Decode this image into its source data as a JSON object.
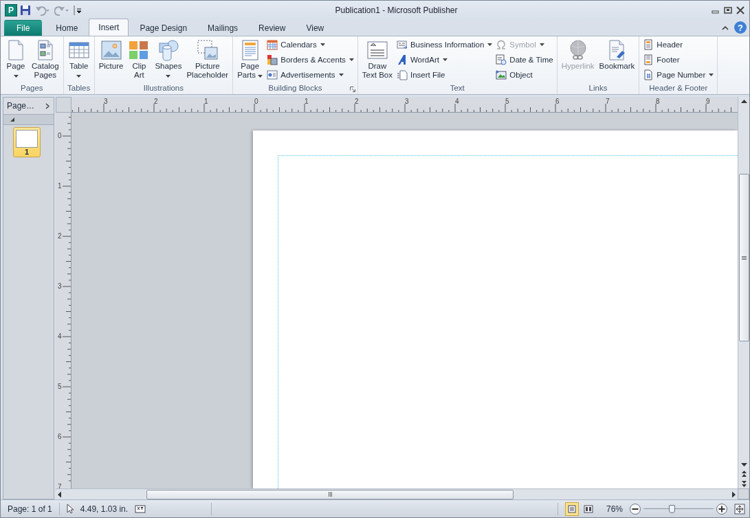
{
  "window": {
    "logo": "P",
    "title": "Publication1 - Microsoft Publisher"
  },
  "ribbon_tabs": [
    {
      "label": "File",
      "kind": "file",
      "selected": false
    },
    {
      "label": "Home",
      "kind": "tab",
      "selected": false
    },
    {
      "label": "Insert",
      "kind": "tab",
      "selected": true
    },
    {
      "label": "Page Design",
      "kind": "tab",
      "selected": false
    },
    {
      "label": "Mailings",
      "kind": "tab",
      "selected": false
    },
    {
      "label": "Review",
      "kind": "tab",
      "selected": false
    },
    {
      "label": "View",
      "kind": "tab",
      "selected": false
    }
  ],
  "help": "?",
  "ribbon": {
    "groups": [
      {
        "label": "Pages",
        "launcher": false,
        "items": [
          {
            "kind": "large",
            "lines": [
              "Page"
            ],
            "dropdown": true,
            "disabled": false
          },
          {
            "kind": "large",
            "lines": [
              "Catalog",
              "Pages"
            ],
            "dropdown": false,
            "disabled": false
          }
        ]
      },
      {
        "label": "Tables",
        "launcher": false,
        "items": [
          {
            "kind": "large",
            "lines": [
              "Table"
            ],
            "dropdown": true,
            "disabled": false
          }
        ]
      },
      {
        "label": "Illustrations",
        "launcher": false,
        "items": [
          {
            "kind": "large",
            "lines": [
              "Picture"
            ],
            "dropdown": false,
            "disabled": false
          },
          {
            "kind": "large",
            "lines": [
              "Clip",
              "Art"
            ],
            "dropdown": false,
            "disabled": false
          },
          {
            "kind": "large",
            "lines": [
              "Shapes"
            ],
            "dropdown": true,
            "disabled": false
          },
          {
            "kind": "large",
            "lines": [
              "Picture",
              "Placeholder"
            ],
            "dropdown": false,
            "disabled": false
          }
        ]
      },
      {
        "label": "Building Blocks",
        "launcher": true,
        "items": [
          {
            "kind": "large",
            "lines": [
              "Page",
              "Parts"
            ],
            "dropdown": true,
            "disabled": false
          },
          {
            "kind": "column",
            "buttons": [
              {
                "label": "Calendars",
                "dropdown": true,
                "disabled": false
              },
              {
                "label": "Borders & Accents",
                "dropdown": true,
                "disabled": false
              },
              {
                "label": "Advertisements",
                "dropdown": true,
                "disabled": false
              }
            ]
          }
        ]
      },
      {
        "label": "Text",
        "launcher": false,
        "items": [
          {
            "kind": "large",
            "lines": [
              "Draw",
              "Text Box"
            ],
            "dropdown": false,
            "disabled": false
          },
          {
            "kind": "column",
            "buttons": [
              {
                "label": "Business Information",
                "dropdown": true,
                "disabled": false
              },
              {
                "label": "WordArt",
                "dropdown": true,
                "disabled": false
              },
              {
                "label": "Insert File",
                "dropdown": false,
                "disabled": false
              }
            ]
          },
          {
            "kind": "column",
            "buttons": [
              {
                "label": "Symbol",
                "dropdown": true,
                "disabled": true
              },
              {
                "label": "Date & Time",
                "dropdown": false,
                "disabled": false
              },
              {
                "label": "Object",
                "dropdown": false,
                "disabled": false
              }
            ]
          }
        ]
      },
      {
        "label": "Links",
        "launcher": false,
        "items": [
          {
            "kind": "large",
            "lines": [
              "Hyperlink"
            ],
            "dropdown": false,
            "disabled": true
          },
          {
            "kind": "large",
            "lines": [
              "Bookmark"
            ],
            "dropdown": false,
            "disabled": false
          }
        ]
      },
      {
        "label": "Header & Footer",
        "launcher": false,
        "items": [
          {
            "kind": "column",
            "buttons": [
              {
                "label": "Header",
                "dropdown": false,
                "disabled": false
              },
              {
                "label": "Footer",
                "dropdown": false,
                "disabled": false
              },
              {
                "label": "Page Number",
                "dropdown": true,
                "disabled": false
              }
            ]
          }
        ]
      }
    ]
  },
  "page_navigation": {
    "title": "Page…",
    "pages": [
      {
        "number": "1",
        "selected": true
      }
    ]
  },
  "rulers": {
    "horizontal": [
      "3",
      "2",
      "1",
      "0",
      "1",
      "2",
      "3",
      "4",
      "5",
      "6",
      "7",
      "8",
      "9"
    ],
    "vertical": [
      "0",
      "1",
      "2",
      "3",
      "4",
      "5",
      "6",
      "7"
    ]
  },
  "status_bar": {
    "page": "Page: 1 of 1",
    "position": "4.49, 1.03 in.",
    "views": [
      {
        "selected": true
      },
      {
        "selected": false
      }
    ],
    "zoom": "76%",
    "zoom_slider": {
      "level": 0.4
    }
  }
}
